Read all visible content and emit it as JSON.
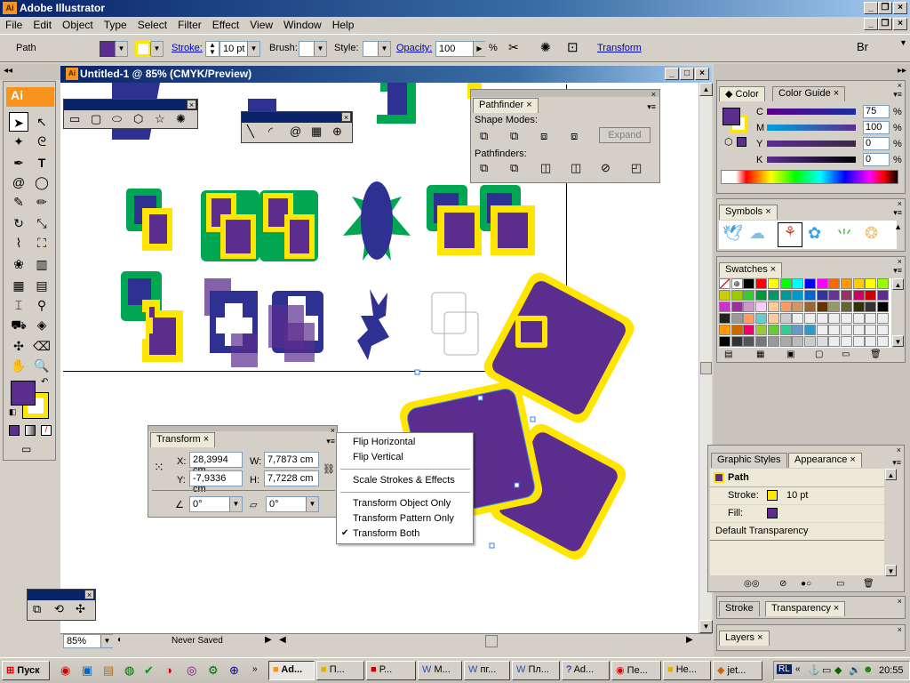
{
  "app": {
    "logo": "Ai",
    "title": "Adobe Illustrator"
  },
  "menu": [
    "File",
    "Edit",
    "Object",
    "Type",
    "Select",
    "Filter",
    "Effect",
    "View",
    "Window",
    "Help"
  ],
  "control_bar": {
    "selection_type": "Path",
    "stroke_label": "Stroke:",
    "stroke_weight": "10 pt",
    "brush_label": "Brush:",
    "style_label": "Style:",
    "opacity_label": "Opacity:",
    "opacity_value": "100",
    "opacity_unit": "%",
    "transform_link": "Transform",
    "bridge_label": "Br",
    "fill_color": "#5b2d8e",
    "stroke_color": "#ffe600"
  },
  "document": {
    "title": "Untitled-1 @ 85% (CMYK/Preview)",
    "zoom": "85%",
    "status": "Never Saved"
  },
  "pathfinder": {
    "tab": "Pathfinder",
    "shape_modes_label": "Shape Modes:",
    "expand_button": "Expand",
    "pathfinders_label": "Pathfinders:"
  },
  "transform_panel": {
    "tab": "Transform",
    "x_label": "X:",
    "x_value": "28,3994 cm",
    "y_label": "Y:",
    "y_value": "-7,9336 cm",
    "w_label": "W:",
    "w_value": "7,7873 cm",
    "h_label": "H:",
    "h_value": "7,7228 cm",
    "rotate_value": "0°",
    "shear_value": "0°"
  },
  "context_menu": {
    "items": [
      {
        "label": "Flip Horizontal",
        "checked": false
      },
      {
        "label": "Flip Vertical",
        "checked": false
      },
      {
        "label": "Scale Strokes & Effects",
        "checked": false
      },
      {
        "label": "Transform Object Only",
        "checked": false
      },
      {
        "label": "Transform Pattern Only",
        "checked": false
      },
      {
        "label": "Transform Both",
        "checked": true
      }
    ],
    "check_mark": "✔"
  },
  "color_panel": {
    "tabs": [
      "Color",
      "Color Guide"
    ],
    "c_label": "C",
    "c_value": "75",
    "m_label": "M",
    "m_value": "100",
    "y_label": "Y",
    "y_value": "0",
    "k_label": "K",
    "k_value": "0",
    "percent": "%"
  },
  "symbols_panel": {
    "tab": "Symbols"
  },
  "swatches_panel": {
    "tab": "Swatches"
  },
  "appearance_panel": {
    "tabs": [
      "Graphic Styles",
      "Appearance"
    ],
    "object": "Path",
    "stroke_label": "Stroke:",
    "stroke_value": "10 pt",
    "fill_label": "Fill:",
    "transparency": "Default Transparency"
  },
  "stroke_transparency_tabs": [
    "Stroke",
    "Transparency"
  ],
  "layers_panel": {
    "tab": "Layers"
  },
  "taskbar": {
    "start": "Пуск",
    "tasks": [
      "Ad...",
      "П...",
      "Р...",
      "М...",
      "пг...",
      "Пл...",
      "Ad...",
      "Пе...",
      "Не...",
      "jet..."
    ],
    "lang": "RL",
    "clock": "20:55"
  }
}
